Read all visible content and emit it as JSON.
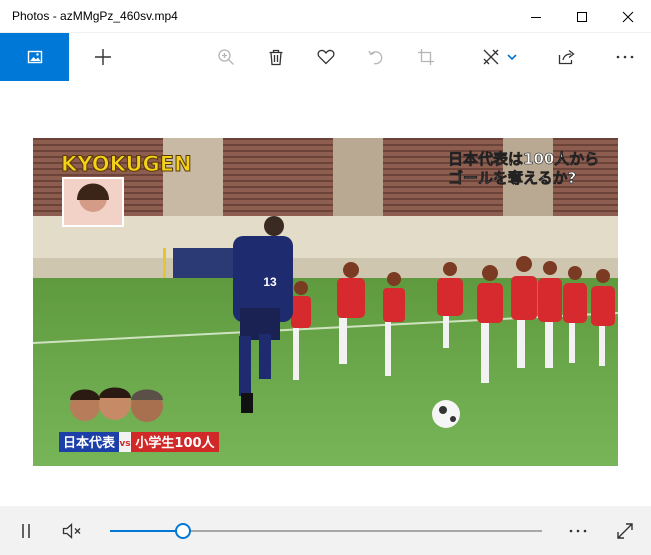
{
  "window": {
    "title": "Photos - azMMgPz_460sv.mp4"
  },
  "titlebar_buttons": [
    {
      "name": "minimize-icon"
    },
    {
      "name": "maximize-icon"
    },
    {
      "name": "close-icon"
    }
  ],
  "toolbar": {
    "items": [
      {
        "name": "photo-icon",
        "active": true
      },
      {
        "name": "add-icon"
      },
      {
        "name": "zoom-in-icon",
        "disabled": true
      },
      {
        "name": "delete-icon"
      },
      {
        "name": "heart-icon"
      },
      {
        "name": "rotate-icon",
        "disabled": true
      },
      {
        "name": "crop-icon",
        "disabled": true
      },
      {
        "name": "edit-draw-icon"
      },
      {
        "name": "chevron-down-icon"
      },
      {
        "name": "share-icon"
      },
      {
        "name": "more-icon"
      }
    ]
  },
  "video_overlay": {
    "show_logo": "KYOKUGEN",
    "caption_line1": "日本代表は100人から",
    "caption_line2": "ゴールを奪えるか?",
    "banner_left": "日本代表",
    "banner_vs": "vs",
    "banner_right": "小学生100人",
    "player_number": "13"
  },
  "playback": {
    "progress": 0.17,
    "controls": [
      "pause-icon",
      "mute-icon",
      "more-icon",
      "fullscreen-icon"
    ]
  },
  "colors": {
    "accent": "#0078d7",
    "titlebar": "#ffffff",
    "bottom_bar": "#f2f2f2"
  }
}
